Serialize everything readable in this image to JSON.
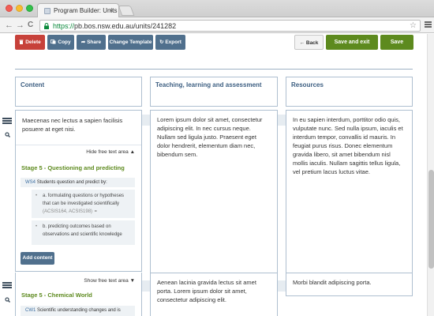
{
  "browser": {
    "tab_title": "Program Builder: Units",
    "tab_close": "×",
    "url_scheme": "https://",
    "url_rest": "pb.bos.nsw.edu.au/units/241282",
    "back": "←",
    "forward": "→",
    "reload": "C",
    "bookmark_star": "☆"
  },
  "toolbar": {
    "delete": "Delete",
    "copy": "Copy",
    "share": "Share",
    "change_template": "Change Template",
    "export": "Export",
    "back": "Back",
    "save_and_exit": "Save and exit",
    "save": "Save"
  },
  "columns": {
    "content": "Content",
    "teaching": "Teaching, learning and assessment",
    "resources": "Resources"
  },
  "rows": [
    {
      "content_text": "Maecenas nec lectus a sapien facilisis posuere at eget nisi.",
      "free_text_toggle": "Hide free text area",
      "stage_title": "Stage 5 - Questioning and predicting",
      "outcome_code": "WS4",
      "outcome_text": "Students question and predict by:",
      "sub_items": [
        {
          "text": "a. formulating questions or hypotheses that can be investigated scientifically",
          "refs": "(ACSIS164, ACSIS198)"
        },
        {
          "text": "b. predicting outcomes based on observations and scientific knowledge"
        }
      ],
      "add_content": "Add content",
      "teaching_text": "Lorem ipsum dolor sit amet, consectetur adipiscing elit. In nec cursus neque. Nullam sed ligula justo. Praesent eget dolor hendrerit, elementum diam nec, bibendum sem.",
      "resources_text": "In eu sapien interdum, porttitor odio quis, vulputate nunc. Sed nulla ipsum, iaculis et interdum tempor, convallis id mauris. In feugiat purus risus. Donec elementum gravida libero, sit amet bibendum nisl mollis iaculis. Nullam sagittis tellus ligula, vel pretium lacus luctus vitae."
    },
    {
      "free_text_toggle": "Show free text area",
      "stage_title": "Stage 5 - Chemical World",
      "outcome_code": "CW1",
      "outcome_text": "Scientific understanding changes and is",
      "teaching_text": "Aenean lacinia gravida lectus sit amet porta. Lorem ipsum dolor sit amet, consectetur adipiscing elit.",
      "resources_text": "Morbi blandit adipiscing porta."
    }
  ],
  "colors": {
    "delete": "#c7413a",
    "action_grey": "#50708d",
    "save_green": "#5d8a1e",
    "stage_green": "#5d8a1e",
    "header_blue": "#3d5f82"
  }
}
